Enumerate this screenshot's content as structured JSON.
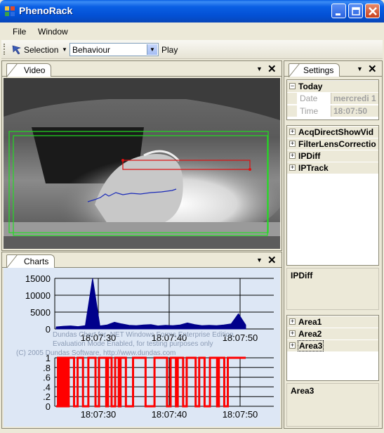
{
  "window": {
    "title": "PhenoRack",
    "colors": {
      "title_bar": "#0a5fe4",
      "close": "#c8401c",
      "panel_bg": "#ece9d8",
      "chart_bg": "#dde7f5"
    }
  },
  "menu": {
    "file": "File",
    "window": "Window"
  },
  "toolbar": {
    "selection_label": "Selection",
    "mode_value": "Behaviour",
    "play_label": "Play"
  },
  "video_panel": {
    "tab": "Video"
  },
  "charts_panel": {
    "tab": "Charts",
    "watermark_1": "Dundas Chart for .NET Windows Forms Enterprise Edition",
    "watermark_2": "Evaluation Mode Enabled, for testing purposes only",
    "watermark_3": "(C) 2005 Dundas Software, http://www.dundas.com"
  },
  "settings_panel": {
    "tab": "Settings",
    "today": {
      "label": "Today",
      "date_label": "Date",
      "date_value": "mercredi 1",
      "time_label": "Time",
      "time_value": "18:07:50"
    },
    "modules": [
      "AcqDirectShowVid",
      "FilterLensCorrectio",
      "IPDiff",
      "IPTrack"
    ],
    "module_description": "IPDiff",
    "areas": [
      "Area1",
      "Area2",
      "Area3"
    ],
    "area_description": "Area3"
  },
  "chart_data": [
    {
      "type": "area",
      "x": [
        "18:07:25",
        "18:07:26",
        "18:07:27",
        "18:07:28",
        "18:07:29",
        "18:07:30",
        "18:07:31",
        "18:07:32",
        "18:07:33",
        "18:07:34",
        "18:07:35",
        "18:07:36",
        "18:07:37",
        "18:07:38",
        "18:07:39",
        "18:07:40",
        "18:07:41",
        "18:07:42",
        "18:07:43",
        "18:07:44",
        "18:07:45",
        "18:07:46",
        "18:07:47",
        "18:07:48",
        "18:07:49",
        "18:07:50",
        "18:07:51"
      ],
      "x_ticks": [
        "18:07:30",
        "18:07:40",
        "18:07:50"
      ],
      "values": [
        600,
        800,
        900,
        700,
        1000,
        15000,
        900,
        1200,
        2000,
        1500,
        1100,
        1000,
        1200,
        1300,
        900,
        1100,
        1000,
        1200,
        1800,
        1300,
        1000,
        1100,
        1000,
        1200,
        1500,
        4500,
        1200
      ],
      "ylim": [
        0,
        15000
      ],
      "y_ticks": [
        0,
        5000,
        10000,
        15000
      ],
      "grid": true,
      "color": "#00008b"
    },
    {
      "type": "line",
      "x_ticks": [
        "18:07:30",
        "18:07:40",
        "18:07:50"
      ],
      "ylim": [
        0,
        1
      ],
      "y_ticks": [
        "0",
        ".2",
        ".4",
        ".6",
        ".8",
        "1"
      ],
      "grid": true,
      "color": "#ff0000",
      "series": [
        {
          "values": [
            0,
            1,
            0,
            1,
            0,
            1,
            0,
            1,
            1,
            1,
            0,
            0,
            1,
            1,
            1,
            0,
            0,
            0,
            1,
            1,
            1,
            1,
            0,
            0,
            1,
            1,
            1,
            1,
            0,
            1,
            1,
            0,
            0,
            1,
            1,
            0,
            1,
            1,
            1,
            0,
            0,
            0,
            0,
            1,
            1,
            1,
            1,
            1,
            1,
            1,
            0,
            0,
            0,
            0,
            0,
            1,
            1,
            1,
            1,
            1,
            1,
            1,
            0,
            0,
            1,
            1,
            1,
            0,
            1,
            1,
            1,
            0,
            0,
            1,
            1,
            1,
            1,
            1,
            0,
            0,
            1,
            1,
            1,
            0,
            0,
            0,
            1,
            1,
            1,
            1,
            0,
            1,
            1,
            1,
            0,
            0,
            1,
            1,
            1,
            1,
            1,
            1,
            1,
            1,
            1,
            1,
            1
          ]
        }
      ]
    }
  ]
}
